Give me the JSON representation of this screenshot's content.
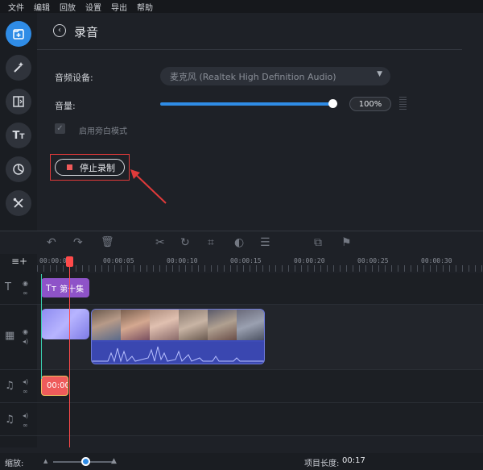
{
  "menu": [
    "文件",
    "编辑",
    "回放",
    "设置",
    "导出",
    "帮助"
  ],
  "sidebar": {
    "items": [
      {
        "icon": "import-icon",
        "active": true
      },
      {
        "icon": "magic-wand-icon",
        "active": false
      },
      {
        "icon": "transition-icon",
        "active": false
      },
      {
        "icon": "titles-icon",
        "active": false
      },
      {
        "icon": "stickers-icon",
        "active": false
      },
      {
        "icon": "tools-icon",
        "active": false
      }
    ]
  },
  "panel": {
    "title": "录音",
    "device_label": "音频设备:",
    "device_value": "麦克风 (Realtek High Definition Audio)",
    "volume_label": "音量:",
    "volume_value": "100%",
    "volume_level": 1.0,
    "mono_label": "启用旁白模式",
    "mono_checked": true,
    "stop_label": "停止录制"
  },
  "toolbar": {
    "icons": [
      "undo-icon",
      "redo-icon",
      "delete-icon",
      "cut-icon",
      "rotate-icon",
      "crop-icon",
      "color-icon",
      "equalizer-icon",
      "clip-properties-icon",
      "flag-icon"
    ]
  },
  "timeline": {
    "add_track_icon": "add-track-icon",
    "ruler": [
      "00:00:00",
      "00:00:05",
      "00:00:10",
      "00:00:15",
      "00:00:20",
      "00:00:25",
      "00:00:30"
    ],
    "title_clip": "第十集",
    "audio_clip": "00:00",
    "title_track_icon": "text-track-icon",
    "video_track_icon": "video-track-icon",
    "audio_track_icon": "music-note-icon"
  },
  "status": {
    "zoom_label": "缩放:",
    "project_length_label": "项目长度:",
    "project_length_value": "00:17"
  },
  "colors": {
    "accent": "#2f8ce6",
    "record": "#f05a5a",
    "title_clip": "#8e53c8",
    "video_clip": "#3d4bb8",
    "audio_clip": "#ee5b5b",
    "playhead": "#ff4a4a"
  }
}
